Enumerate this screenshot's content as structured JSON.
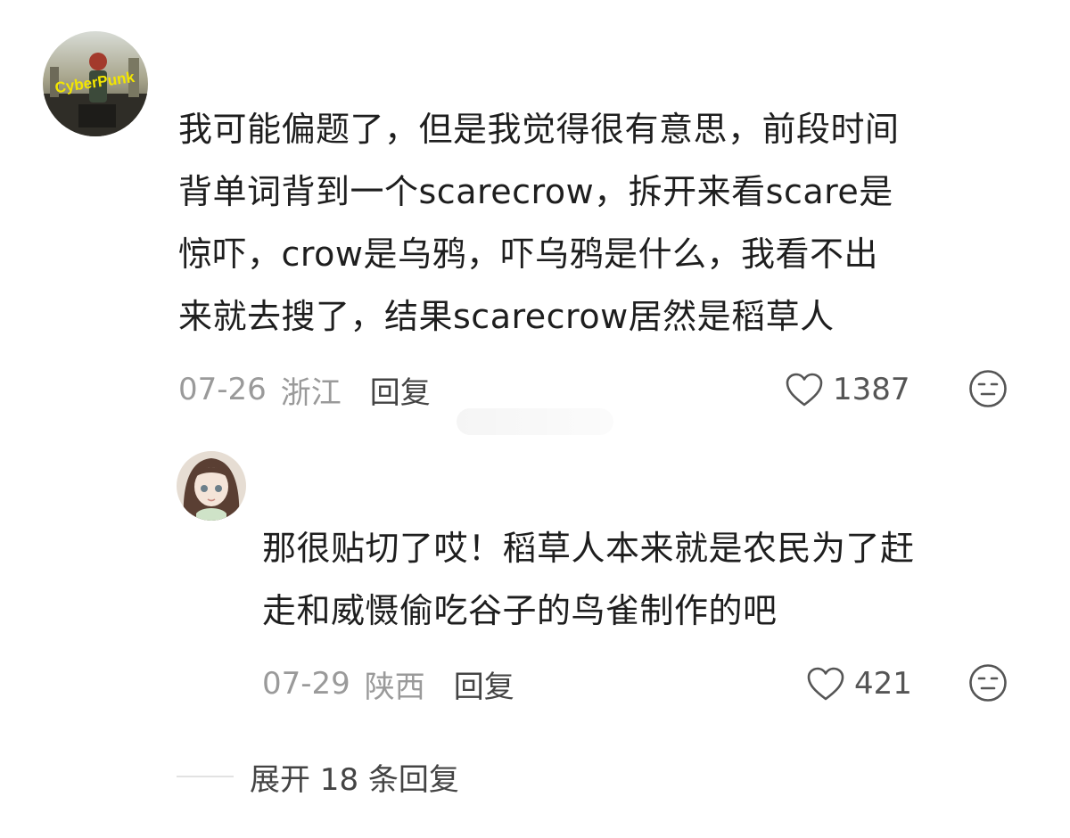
{
  "comments": [
    {
      "lines": [
        "我可能偏题了，但是我觉得很有意思，前段时间",
        "背单词背到一个scarecrow，拆开来看scare是",
        "惊吓，crow是乌鸦，吓乌鸦是什么，我看不出",
        "来就去搜了，结果scarecrow居然是稻草人"
      ],
      "date": "07-26",
      "region": "浙江",
      "reply_label": "回复",
      "likes": "1387",
      "avatar_logo_text": "CyberPunk"
    },
    {
      "lines": [
        "那很贴切了哎！稻草人本来就是农民为了赶",
        "走和威慑偷吃谷子的鸟雀制作的吧"
      ],
      "date": "07-29",
      "region": "陕西",
      "reply_label": "回复",
      "likes": "421"
    }
  ],
  "expand_label": "展开 18 条回复",
  "colors": {
    "text": "#1e1e1e",
    "meta": "#9a9a9a",
    "action": "#444444",
    "divider": "#e2e2e2"
  }
}
